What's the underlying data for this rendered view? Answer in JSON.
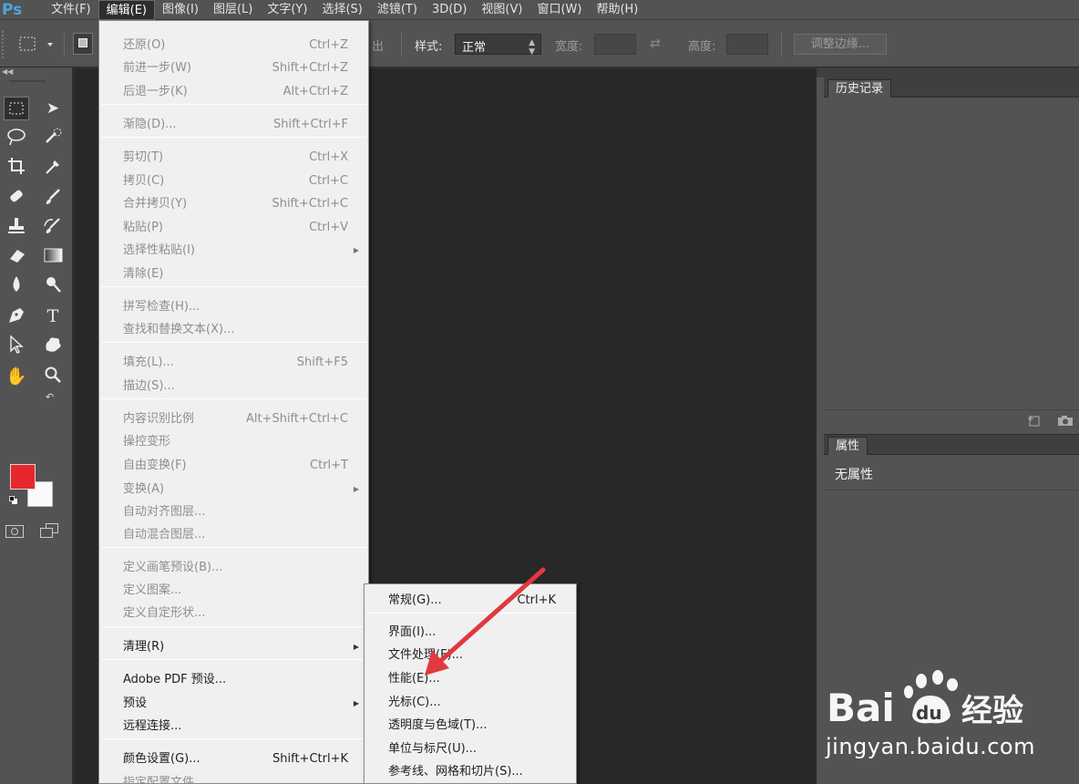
{
  "app": {
    "logo": "Ps"
  },
  "menubar": {
    "items": [
      "文件(F)",
      "编辑(E)",
      "图像(I)",
      "图层(L)",
      "文字(Y)",
      "选择(S)",
      "滤镜(T)",
      "3D(D)",
      "视图(V)",
      "窗口(W)",
      "帮助(H)"
    ],
    "active_index": 1
  },
  "options": {
    "feather_partial": "出",
    "style_label": "样式:",
    "style_value": "正常",
    "width_label": "宽度:",
    "height_label": "高度:",
    "refine_edge_label": "调整边缘..."
  },
  "colors": {
    "foreground": "#e8262d",
    "background": "#fafafa",
    "arrow": "#e0393f"
  },
  "panels": {
    "history_tab": "历史记录",
    "properties_tab": "属性",
    "properties_empty": "无属性"
  },
  "edit_menu": {
    "items": [
      {
        "label": "还原(O)",
        "shortcut": "Ctrl+Z",
        "disabled": true
      },
      {
        "label": "前进一步(W)",
        "shortcut": "Shift+Ctrl+Z",
        "disabled": true
      },
      {
        "label": "后退一步(K)",
        "shortcut": "Alt+Ctrl+Z",
        "disabled": true
      },
      {
        "label": "渐隐(D)...",
        "shortcut": "Shift+Ctrl+F",
        "disabled": true
      },
      {
        "label": "剪切(T)",
        "shortcut": "Ctrl+X",
        "disabled": true
      },
      {
        "label": "拷贝(C)",
        "shortcut": "Ctrl+C",
        "disabled": true
      },
      {
        "label": "合并拷贝(Y)",
        "shortcut": "Shift+Ctrl+C",
        "disabled": true
      },
      {
        "label": "粘贴(P)",
        "shortcut": "Ctrl+V",
        "disabled": true
      },
      {
        "label": "选择性粘贴(I)",
        "shortcut": "",
        "disabled": true,
        "submenu": true
      },
      {
        "label": "清除(E)",
        "shortcut": "",
        "disabled": true
      },
      {
        "label": "拼写检查(H)...",
        "shortcut": "",
        "disabled": true
      },
      {
        "label": "查找和替换文本(X)...",
        "shortcut": "",
        "disabled": true
      },
      {
        "label": "填充(L)...",
        "shortcut": "Shift+F5",
        "disabled": true
      },
      {
        "label": "描边(S)...",
        "shortcut": "",
        "disabled": true
      },
      {
        "label": "内容识别比例",
        "shortcut": "Alt+Shift+Ctrl+C",
        "disabled": true
      },
      {
        "label": "操控变形",
        "shortcut": "",
        "disabled": true
      },
      {
        "label": "自由变换(F)",
        "shortcut": "Ctrl+T",
        "disabled": true
      },
      {
        "label": "变换(A)",
        "shortcut": "",
        "disabled": true,
        "submenu": true
      },
      {
        "label": "自动对齐图层...",
        "shortcut": "",
        "disabled": true
      },
      {
        "label": "自动混合图层...",
        "shortcut": "",
        "disabled": true
      },
      {
        "label": "定义画笔预设(B)...",
        "shortcut": "",
        "disabled": true
      },
      {
        "label": "定义图案...",
        "shortcut": "",
        "disabled": true
      },
      {
        "label": "定义自定形状...",
        "shortcut": "",
        "disabled": true
      },
      {
        "label": "清理(R)",
        "shortcut": "",
        "disabled": false,
        "submenu": true
      },
      {
        "label": "Adobe PDF 预设...",
        "shortcut": "",
        "disabled": false
      },
      {
        "label": "预设",
        "shortcut": "",
        "disabled": false,
        "submenu": true
      },
      {
        "label": "远程连接...",
        "shortcut": "",
        "disabled": false
      },
      {
        "label": "颜色设置(G)...",
        "shortcut": "Shift+Ctrl+K",
        "disabled": false
      },
      {
        "label": "指定配置文件...",
        "shortcut": "",
        "disabled": true
      }
    ]
  },
  "prefs_menu": {
    "items": [
      {
        "label": "常规(G)...",
        "shortcut": "Ctrl+K"
      },
      {
        "label": "界面(I)..."
      },
      {
        "label": "文件处理(F)..."
      },
      {
        "label": "性能(E)..."
      },
      {
        "label": "光标(C)..."
      },
      {
        "label": "透明度与色域(T)..."
      },
      {
        "label": "单位与标尺(U)..."
      },
      {
        "label": "参考线、网格和切片(S)..."
      }
    ]
  },
  "watermark": {
    "brand": "Bai du 经验",
    "url": "jingyan.baidu.com"
  }
}
